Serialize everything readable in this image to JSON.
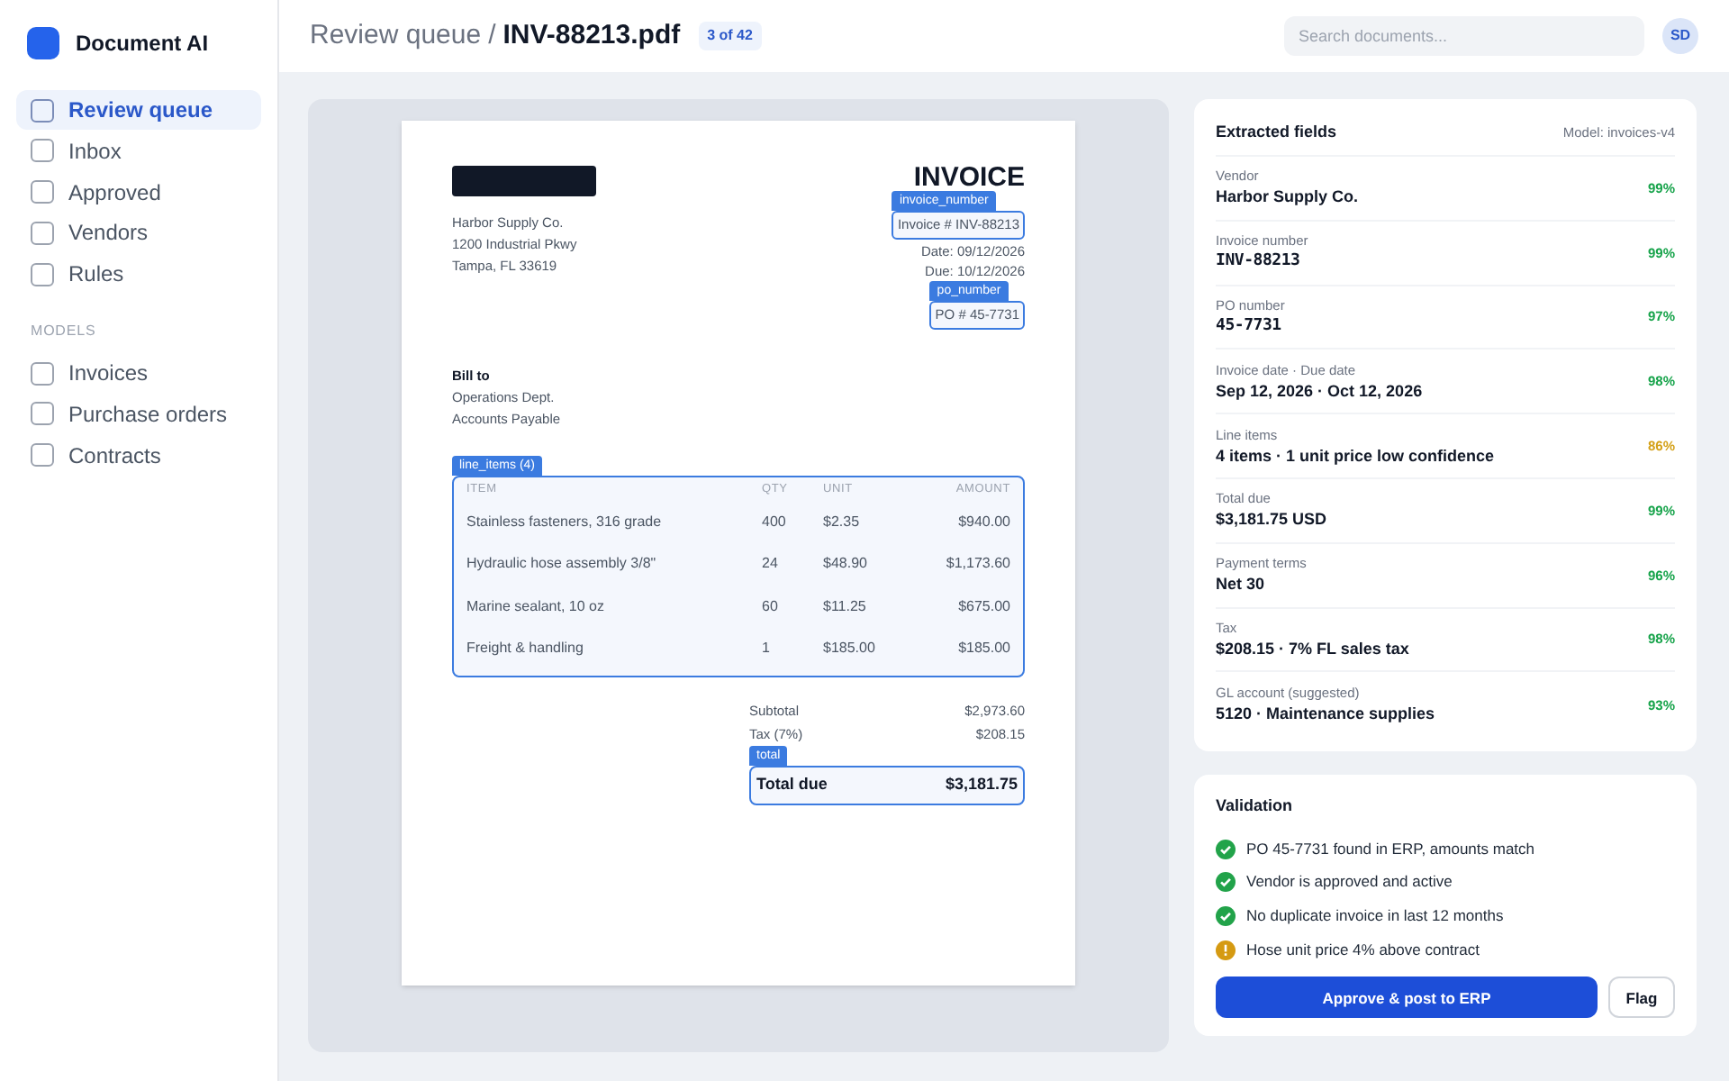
{
  "app": {
    "name": "Document AI"
  },
  "sidebar": {
    "items": [
      {
        "label": "Review queue",
        "selected": true
      },
      {
        "label": "Inbox",
        "selected": false
      },
      {
        "label": "Approved",
        "selected": false
      },
      {
        "label": "Vendors",
        "selected": false
      },
      {
        "label": "Rules",
        "selected": false
      }
    ],
    "section_title": "MODELS",
    "model_items": [
      {
        "label": "Invoices",
        "selected": false
      },
      {
        "label": "Purchase orders",
        "selected": false
      },
      {
        "label": "Contracts",
        "selected": false
      }
    ]
  },
  "header": {
    "breadcrumb": "Review queue",
    "separator": "/",
    "file": "INV-88213.pdf",
    "position": "3 of 42",
    "search": {
      "placeholder": "Search documents..."
    },
    "avatar": "SD"
  },
  "document": {
    "title": "INVOICE",
    "sender": [
      "Harbor Supply Co.",
      "1200 Industrial Pkwy",
      "Tampa, FL 33619"
    ],
    "invoice_tag": "invoice_number",
    "invoice_no": "Invoice # INV-88213",
    "date": "Date: 09/12/2026",
    "due": "Due: 10/12/2026",
    "po_tag": "po_number",
    "po": "PO # 45-7731",
    "bill_to_title": "Bill to",
    "bill_to": [
      "Operations Dept.",
      "Accounts Payable"
    ],
    "items_tag": "line_items (4)",
    "columns": [
      "ITEM",
      "QTY",
      "UNIT",
      "AMOUNT"
    ],
    "rows": [
      [
        "Stainless fasteners, 316 grade",
        "400",
        "$2.35",
        "$940.00"
      ],
      [
        "Hydraulic hose assembly 3/8\"",
        "24",
        "$48.90",
        "$1,173.60"
      ],
      [
        "Marine sealant, 10 oz",
        "60",
        "$11.25",
        "$675.00"
      ],
      [
        "Freight & handling",
        "1",
        "$185.00",
        "$185.00"
      ]
    ],
    "subtotal_label": "Subtotal",
    "subtotal": "$2,973.60",
    "tax_label": "Tax (7%)",
    "tax": "$208.15",
    "total_tag": "total",
    "total_label": "Total due",
    "total": "$3,181.75"
  },
  "extracted": {
    "title": "Extracted fields",
    "model": "Model: invoices-v4",
    "fields": [
      {
        "label": "Vendor",
        "value": "Harbor Supply Co.",
        "mono": false,
        "confidence": "99%",
        "color": "#16a34a"
      },
      {
        "label": "Invoice number",
        "value": "INV-88213",
        "mono": true,
        "confidence": "99%",
        "color": "#16a34a"
      },
      {
        "label": "PO number",
        "value": "45-7731",
        "mono": true,
        "confidence": "97%",
        "color": "#16a34a"
      },
      {
        "label": "Invoice date · Due date",
        "value": "Sep 12, 2026 · Oct 12, 2026",
        "mono": false,
        "confidence": "98%",
        "color": "#16a34a"
      },
      {
        "label": "Line items",
        "value": "4 items · 1 unit price low confidence",
        "mono": false,
        "confidence": "86%",
        "color": "#d4a017"
      },
      {
        "label": "Total due",
        "value": "$3,181.75 USD",
        "mono": false,
        "confidence": "99%",
        "color": "#16a34a"
      },
      {
        "label": "Payment terms",
        "value": "Net 30",
        "mono": false,
        "confidence": "96%",
        "color": "#16a34a"
      },
      {
        "label": "Tax",
        "value": "$208.15 · 7% FL sales tax",
        "mono": false,
        "confidence": "98%",
        "color": "#16a34a"
      },
      {
        "label": "GL account (suggested)",
        "value": "5120 · Maintenance supplies",
        "mono": false,
        "confidence": "93%",
        "color": "#16a34a"
      }
    ]
  },
  "validation": {
    "title": "Validation",
    "checks": [
      {
        "text": "PO 45-7731 found in ERP, amounts match",
        "kind": "ok"
      },
      {
        "text": "Vendor is approved and active",
        "kind": "ok"
      },
      {
        "text": "No duplicate invoice in last 12 months",
        "kind": "ok"
      },
      {
        "text": "Hose unit price 4% above contract",
        "kind": "warning"
      }
    ],
    "primary_button": "Approve & post to ERP",
    "secondary_button": "Flag"
  }
}
